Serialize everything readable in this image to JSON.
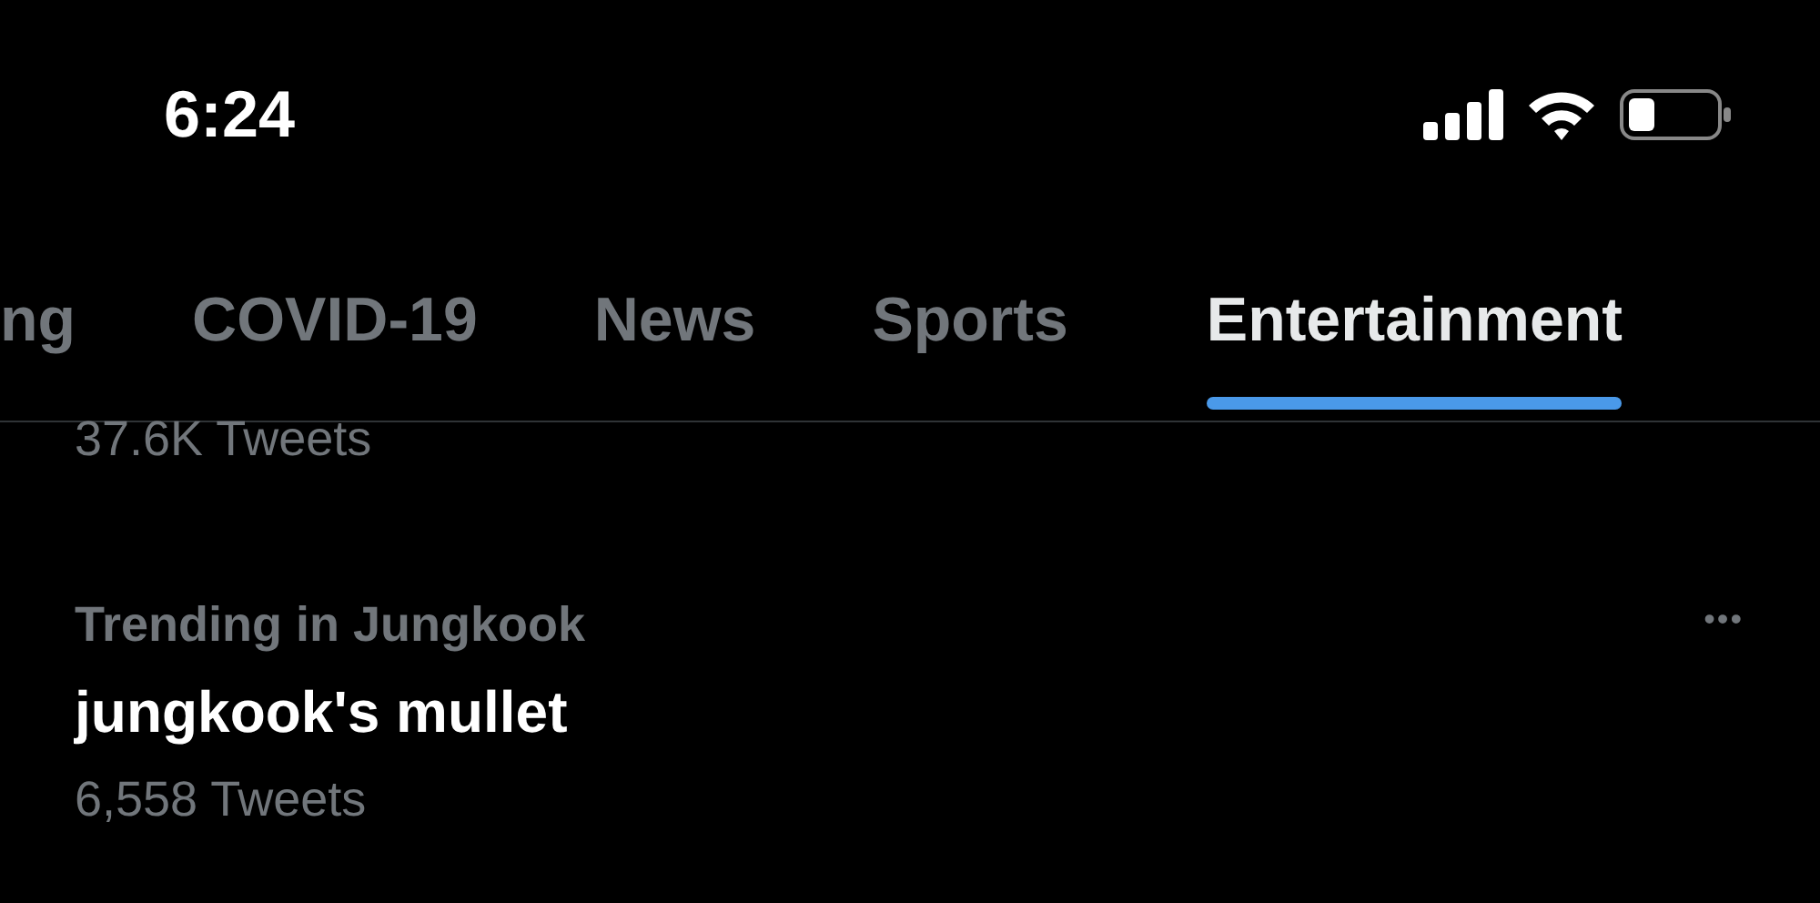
{
  "status_bar": {
    "time": "6:24"
  },
  "tabs": [
    {
      "label": "ng",
      "selected": false
    },
    {
      "label": "COVID-19",
      "selected": false
    },
    {
      "label": "News",
      "selected": false
    },
    {
      "label": "Sports",
      "selected": false
    },
    {
      "label": "Entertainment",
      "selected": true
    }
  ],
  "previous_trend": {
    "count": "37.6K Tweets"
  },
  "trends": [
    {
      "context": "Trending in Jungkook",
      "topic": "jungkook's mullet",
      "count": "6,558 Tweets",
      "more": "•••"
    }
  ]
}
